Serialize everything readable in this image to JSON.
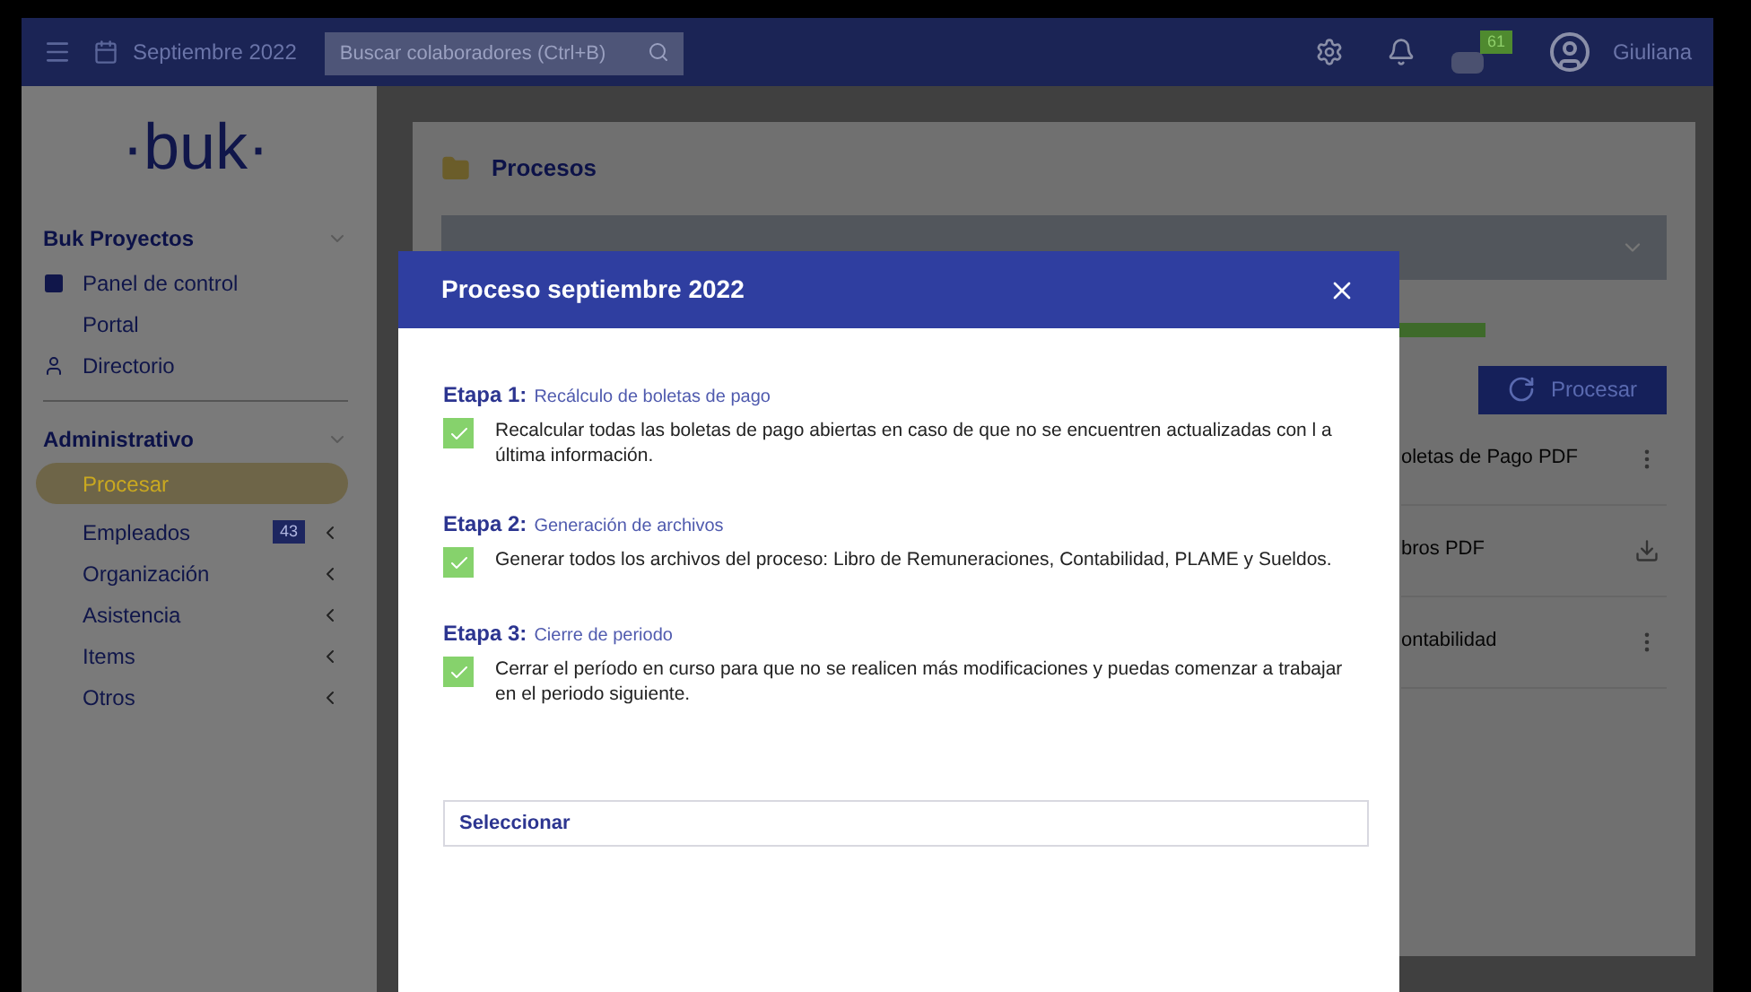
{
  "topbar": {
    "period": "Septiembre 2022",
    "search": {
      "placeholder": "Buscar colaboradores (Ctrl+B)"
    },
    "notifications_badge": "61",
    "user": "Giuliana"
  },
  "sidebar": {
    "logo": "·buk·",
    "sections": [
      {
        "title": "Buk Proyectos",
        "items": [
          {
            "label": "Panel de control",
            "kind": "dashboard",
            "selected": false
          },
          {
            "label": "Portal",
            "kind": "plain",
            "selected": false
          },
          {
            "label": "Directorio",
            "kind": "person",
            "selected": false
          }
        ]
      },
      {
        "title": "Administrativo",
        "items": [
          {
            "label": "Procesar",
            "selected": true
          },
          {
            "label": "Empleados",
            "badge": "43",
            "expandable": true,
            "selected": false
          },
          {
            "label": "Organización",
            "expandable": true,
            "selected": false
          },
          {
            "label": "Asistencia",
            "expandable": true,
            "selected": false
          },
          {
            "label": "Items",
            "expandable": true,
            "selected": false
          },
          {
            "label": "Otros",
            "expandable": true,
            "selected": false
          }
        ]
      }
    ]
  },
  "page": {
    "title": "Procesos",
    "process_button": "Procesar",
    "files": [
      {
        "label": "oletas de Pago PDF",
        "kind": "menu"
      },
      {
        "label": "bros PDF",
        "kind": "download"
      },
      {
        "label": "ontabilidad",
        "kind": "menu"
      }
    ]
  },
  "dialog": {
    "title": "Proceso septiembre 2022",
    "stages": [
      {
        "label": "Etapa 1:",
        "name": "Recálculo de boletas de pago",
        "description": "Recalcular todas las boletas de pago abiertas en caso de que no se encuentren actualizadas con l a última información.",
        "checked": true
      },
      {
        "label": "Etapa 2:",
        "name": "Generación de archivos",
        "description": "Generar todos los archivos del proceso: Libro de Remuneraciones, Contabilidad, PLAME y Sueldos.",
        "checked": true
      },
      {
        "label": "Etapa 3:",
        "name": "Cierre de periodo",
        "description": "Cerrar el período en curso para que no se realicen más modificaciones y puedas comenzar a trabajar en el periodo siguiente.",
        "checked": true
      }
    ],
    "select_button": "Seleccionar"
  }
}
